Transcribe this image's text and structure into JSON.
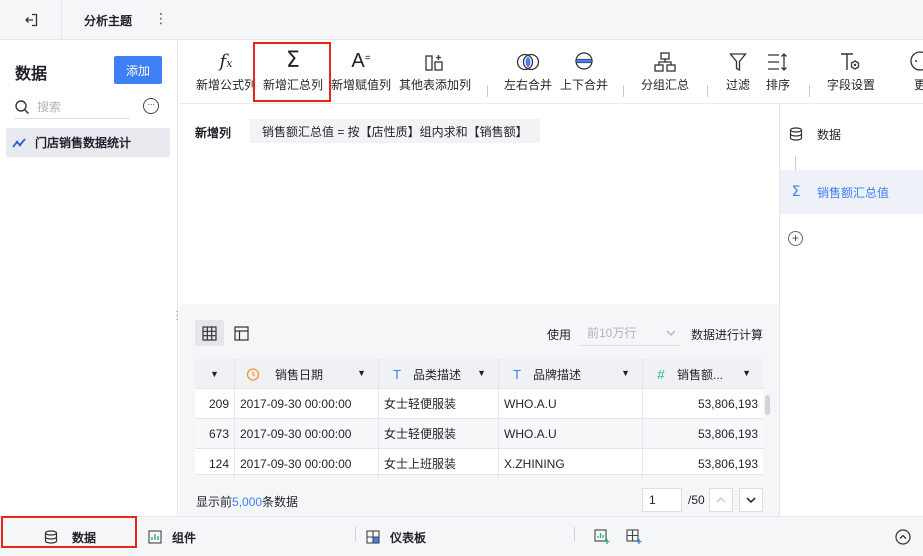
{
  "topbar": {
    "title": "分析主题",
    "more": "⋮"
  },
  "left_panel": {
    "title": "数据",
    "add_button": "添加",
    "search_placeholder": "搜索",
    "more": "···",
    "dataset_name": "门店销售数据统计"
  },
  "toolbar": {
    "items": [
      {
        "label": "新增公式列",
        "icon": "fx-icon"
      },
      {
        "label": "新增汇总列",
        "icon": "sigma-icon"
      },
      {
        "label": "新增赋值列",
        "icon": "assign-icon"
      },
      {
        "label": "其他表添加列",
        "icon": "add-column-icon"
      },
      {
        "label": "左右合并",
        "icon": "merge-horizontal-icon"
      },
      {
        "label": "上下合并",
        "icon": "merge-vertical-icon"
      },
      {
        "label": "分组汇总",
        "icon": "group-icon"
      },
      {
        "label": "过滤",
        "icon": "filter-icon"
      },
      {
        "label": "排序",
        "icon": "sort-icon"
      },
      {
        "label": "字段设置",
        "icon": "field-settings-icon"
      },
      {
        "label": "更",
        "icon": "more-icon"
      }
    ]
  },
  "formula": {
    "label": "新增列",
    "expression": "销售额汇总值 = 按【店性质】组内求和【销售额】"
  },
  "steps": {
    "items": [
      {
        "label": "数据",
        "icon": "database-icon"
      },
      {
        "label": "销售额汇总值",
        "icon": "sigma-icon"
      }
    ]
  },
  "preview": {
    "use_label": "使用",
    "rows_option": "前10万行",
    "calc_label": "数据进行计算",
    "columns": [
      {
        "name": "",
        "type": ""
      },
      {
        "name": "销售日期",
        "type": "date"
      },
      {
        "name": "品类描述",
        "type": "text"
      },
      {
        "name": "品牌描述",
        "type": "text"
      },
      {
        "name": "销售额...",
        "type": "number"
      }
    ],
    "rows": [
      [
        "209",
        "2017-09-30 00:00:00",
        "女士轻便服装",
        "WHO.A.U",
        "53,806,193"
      ],
      [
        "673",
        "2017-09-30 00:00:00",
        "女士轻便服装",
        "WHO.A.U",
        "53,806,193"
      ],
      [
        "124",
        "2017-09-30 00:00:00",
        "女士上班服装",
        "X.ZHINING",
        "53,806,193"
      ]
    ],
    "footer_prefix": "显示前",
    "footer_count": "5,000",
    "footer_suffix": "条数据",
    "page_value": "1",
    "page_total": "/50"
  },
  "bottom_tabs": {
    "data": "数据",
    "component": "组件",
    "dashboard": "仪表板"
  },
  "colors": {
    "accent": "#3d7ff5",
    "highlight": "#e6271d"
  }
}
